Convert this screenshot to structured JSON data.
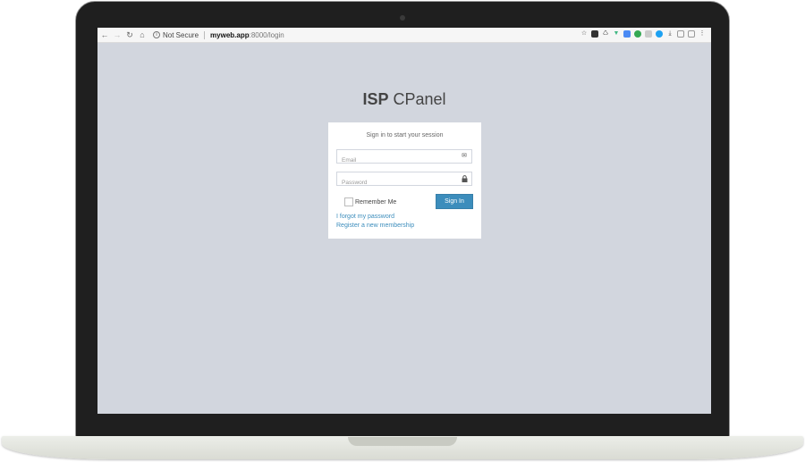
{
  "browser": {
    "security_label": "Not Secure",
    "url_host": "myweb.app",
    "url_rest": ":8000/login"
  },
  "page": {
    "logo_bold": "ISP",
    "logo_light": " CPanel",
    "login": {
      "message": "Sign in to start your session",
      "email_placeholder": "Email",
      "password_placeholder": "Password",
      "remember_label": "Remember Me",
      "signin_label": "Sign In",
      "forgot_link": "I forgot my password",
      "register_link": "Register a new membership"
    }
  },
  "colors": {
    "page_background": "#d2d6de",
    "primary_button": "#3c8dbc",
    "link": "#3c8dbc"
  },
  "icons": [
    "back-icon",
    "forward-icon",
    "reload-icon",
    "home-icon",
    "info-icon",
    "star-icon",
    "envelope-icon",
    "lock-icon"
  ]
}
